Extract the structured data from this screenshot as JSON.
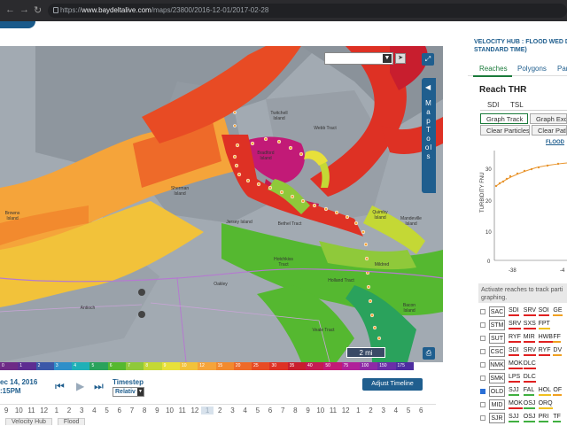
{
  "browser": {
    "url_host": "www.baydeltalive.com",
    "url_path": "/maps/23800/2016-12-01/2017-02-28"
  },
  "map": {
    "scale_label": "2 mi",
    "expand_icon": "expand-icon",
    "print_icon": "print-icon",
    "map_tools_label": "Map Tools",
    "labels": [
      {
        "name": "Twitchell Island",
        "text": "Twitchell Island"
      },
      {
        "name": "Sherman Island",
        "text": "Sherman Island"
      },
      {
        "name": "Bradford Island",
        "text": "Bradford Island"
      },
      {
        "name": "Webb Tract",
        "text": "Webb Tract"
      },
      {
        "name": "Jersey Island",
        "text": "Jersey Island"
      },
      {
        "name": "Bethel Tract",
        "text": "Bethel Tract"
      },
      {
        "name": "Quimby Island",
        "text": "Quimby Island"
      },
      {
        "name": "Mandeville Island",
        "text": "Mandeville Island"
      },
      {
        "name": "Hotchkiss Tract",
        "text": "Hotchkiss Tract"
      },
      {
        "name": "Holland Tract",
        "text": "Holland Tract"
      },
      {
        "name": "Veale Tract",
        "text": "Veale Tract"
      },
      {
        "name": "Bacon Island",
        "text": "Bacon Island"
      },
      {
        "name": "Oakley",
        "text": "Oakley"
      },
      {
        "name": "Antioch",
        "text": "Antioch"
      },
      {
        "name": "Brown Island",
        "text": "Browns Island"
      },
      {
        "name": "Mildred",
        "text": "Mildred"
      }
    ]
  },
  "legend": {
    "values": [
      "0",
      "1",
      "2",
      "3",
      "4",
      "5",
      "6",
      "7",
      "8",
      "9",
      "10",
      "12",
      "15",
      "20",
      "25",
      "30",
      "35",
      "40",
      "50",
      "75",
      "100",
      "150",
      "175"
    ],
    "colors": [
      "#6e2a86",
      "#5d2d91",
      "#3b58a8",
      "#2f8fc9",
      "#1fb0b7",
      "#2aa25c",
      "#55b830",
      "#8fc93a",
      "#c4d835",
      "#e8e03a",
      "#f2c23a",
      "#f5a43a",
      "#f28a2e",
      "#ee6a29",
      "#e84b24",
      "#de3124",
      "#c81e2e",
      "#c41b52",
      "#c21a77",
      "#b0209a",
      "#8e2aa6",
      "#6b2fa8",
      "#4d2da0"
    ]
  },
  "time_controls": {
    "date_line1": "ec 14, 2016",
    "date_line2": ":15PM",
    "timestep_label": "Timestep",
    "timestep_value": "Relativ",
    "adjust_timeline": "Adjust Timeline"
  },
  "timeline": {
    "ticks": [
      "9",
      "10",
      "11",
      "12",
      "1",
      "2",
      "3",
      "4",
      "5",
      "6",
      "7",
      "8",
      "9",
      "10",
      "11",
      "12",
      "1",
      "2",
      "3",
      "4",
      "5",
      "6",
      "7",
      "8",
      "9",
      "10",
      "11",
      "12",
      "1",
      "2",
      "3",
      "4",
      "5",
      "6"
    ],
    "selected_index": 16
  },
  "bottom_tabs": [
    "Velocity Hub",
    "Flood"
  ],
  "panel": {
    "title_line1": "VELOCITY HUB : FLOOD WED DE",
    "title_line2": "STANDARD TIME)",
    "tabs": [
      "Reaches",
      "Polygons",
      "Para"
    ],
    "reach_title": "Reach THR",
    "sub_tabs": [
      "SDI",
      "TSL"
    ],
    "buttons": {
      "graph_track": "Graph Track",
      "graph_exceed": "Graph Excee",
      "clear_particles": "Clear Particles",
      "clear_paths": "Clear Path"
    },
    "flood_link": "FLOOD",
    "graph": {
      "ylabel": "TURBIDITY FNU",
      "y_ticks": [
        "30",
        "20",
        "10",
        "0"
      ],
      "x_ticks": [
        "-38",
        "-4"
      ]
    },
    "instructions": "Activate reaches to track parti graphing.",
    "reaches": [
      {
        "code": "SAC",
        "checked": false,
        "subs": [
          {
            "t": "SDI",
            "c": "#e02020"
          },
          {
            "t": "SRV",
            "c": "#e02020"
          },
          {
            "t": "SOI",
            "c": "#e02020"
          },
          {
            "t": "GE",
            "c": "#f0a020"
          }
        ]
      },
      {
        "code": "STM",
        "checked": false,
        "subs": [
          {
            "t": "SRV",
            "c": "#e02020"
          },
          {
            "t": "SXS",
            "c": "#e02020"
          },
          {
            "t": "FPT",
            "c": "#f0c020"
          }
        ]
      },
      {
        "code": "SUT",
        "checked": false,
        "subs": [
          {
            "t": "RYF",
            "c": "#e02020"
          },
          {
            "t": "MIR",
            "c": "#e02020"
          },
          {
            "t": "HWB",
            "c": "#e02020"
          },
          {
            "t": "FF",
            "c": "#f0a020"
          }
        ]
      },
      {
        "code": "CSC",
        "checked": false,
        "subs": [
          {
            "t": "SDI",
            "c": "#e02020"
          },
          {
            "t": "SRV",
            "c": "#e02020"
          },
          {
            "t": "RYF",
            "c": "#e02020"
          },
          {
            "t": "DV",
            "c": "#f0a020"
          }
        ]
      },
      {
        "code": "NMK",
        "checked": false,
        "subs": [
          {
            "t": "MOK",
            "c": "#e02020"
          },
          {
            "t": "DLC",
            "c": "#e02020"
          }
        ]
      },
      {
        "code": "SMK",
        "checked": false,
        "subs": [
          {
            "t": "LPS",
            "c": "#e02020"
          },
          {
            "t": "DLC",
            "c": "#e02020"
          }
        ]
      },
      {
        "code": "OLD",
        "checked": true,
        "subs": [
          {
            "t": "SJJ",
            "c": "#40b040"
          },
          {
            "t": "FAL",
            "c": "#40b040"
          },
          {
            "t": "HOL",
            "c": "#f0c020"
          },
          {
            "t": "OF",
            "c": "#f0a020"
          }
        ]
      },
      {
        "code": "MID",
        "checked": false,
        "subs": [
          {
            "t": "MOK",
            "c": "#e02020"
          },
          {
            "t": "OSJ",
            "c": "#40b040"
          },
          {
            "t": "ORQ",
            "c": "#f0c020"
          }
        ]
      },
      {
        "code": "SJR",
        "checked": false,
        "subs": [
          {
            "t": "SJJ",
            "c": "#40b040"
          },
          {
            "t": "OSJ",
            "c": "#40b040"
          },
          {
            "t": "PRI",
            "c": "#40b040"
          },
          {
            "t": "TF",
            "c": "#40b040"
          }
        ]
      }
    ]
  }
}
